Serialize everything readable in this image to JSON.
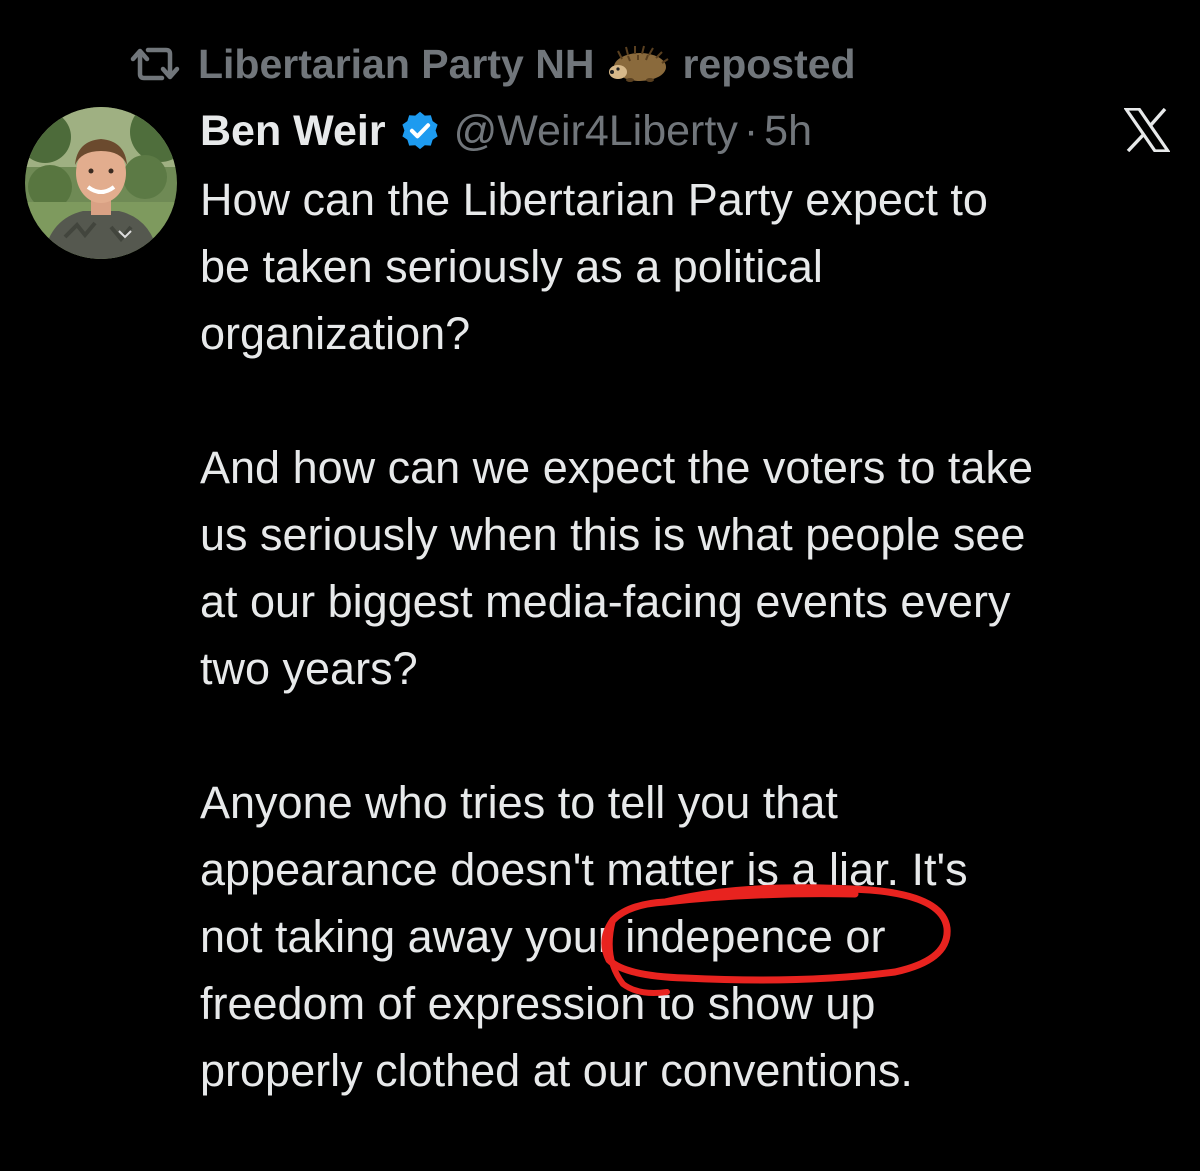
{
  "repost_banner": {
    "account_name": "Libertarian Party NH",
    "emoji": "hedgehog",
    "suffix": "reposted",
    "icon": "repost-icon"
  },
  "author": {
    "name": "Ben Weir",
    "verified_icon": "verified-badge-icon",
    "handle": "@Weir4Liberty",
    "separator": "·",
    "time": "5h",
    "avatar": "avatar-photo"
  },
  "brand_logo": "x-logo-icon",
  "tweet": {
    "paragraphs": [
      {
        "lines": [
          "How can the Libertarian Party expect to",
          "be taken seriously as a political",
          "organization?"
        ]
      },
      {
        "lines": [
          "And how can we expect the voters to take",
          "us seriously when this is what people see",
          "at our biggest media-facing events every",
          "two years?"
        ]
      },
      {
        "lines": [
          "Anyone who tries to tell you that",
          "appearance doesn't matter is a liar. It's",
          "not taking away your indepence or",
          "freedom of expression to show up",
          "properly clothed at our conventions."
        ]
      }
    ]
  },
  "annotation": {
    "type": "hand-drawn red circle",
    "target_word": "indepence",
    "color": "#e8231f"
  },
  "colors": {
    "background": "#000000",
    "primary_text": "#e7e9ea",
    "secondary_text": "#71767b",
    "verified_blue": "#1d9bf0",
    "annotation_red": "#e8231f"
  }
}
